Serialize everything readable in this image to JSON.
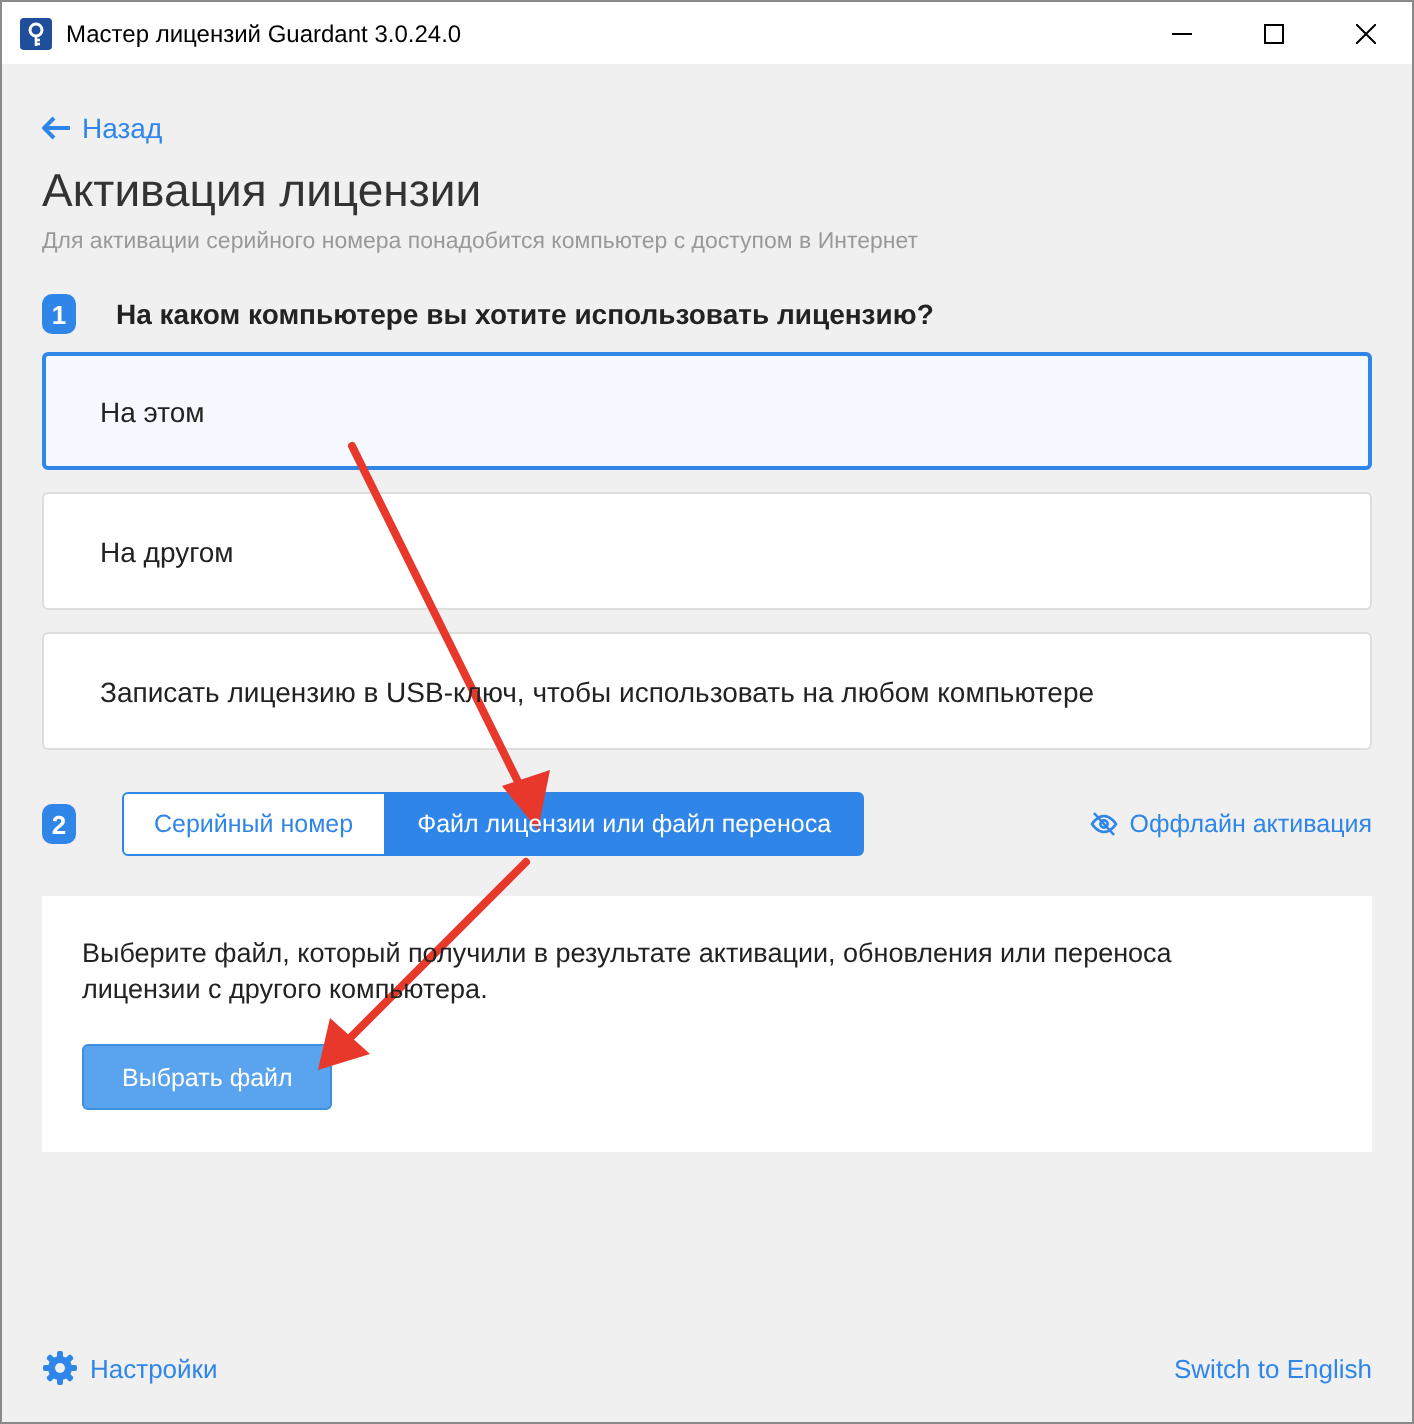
{
  "window": {
    "title": "Мастер лицензий Guardant 3.0.24.0"
  },
  "back_link": "Назад",
  "heading": "Активация лицензии",
  "subtitle": "Для активации серийного номера понадобится компьютер с доступом в Интернет",
  "step1": {
    "number": "1",
    "question": "На каком компьютере вы хотите использовать лицензию?",
    "options": [
      {
        "label": "На этом",
        "selected": true
      },
      {
        "label": "На другом",
        "selected": false
      },
      {
        "label": "Записать лицензию в USB-ключ, чтобы использовать на любом компьютере",
        "selected": false
      }
    ]
  },
  "step2": {
    "number": "2",
    "tabs": [
      {
        "label": "Серийный номер",
        "selected": false
      },
      {
        "label": "Файл лицензии или файл переноса",
        "selected": true
      }
    ],
    "offline_link": "Оффлайн активация",
    "panel": {
      "text": "Выберите файл, который получили в результате активации, обновления или переноса лицензии с другого компьютера.",
      "button": "Выбрать файл"
    }
  },
  "footer": {
    "settings": "Настройки",
    "language": "Switch to English"
  }
}
